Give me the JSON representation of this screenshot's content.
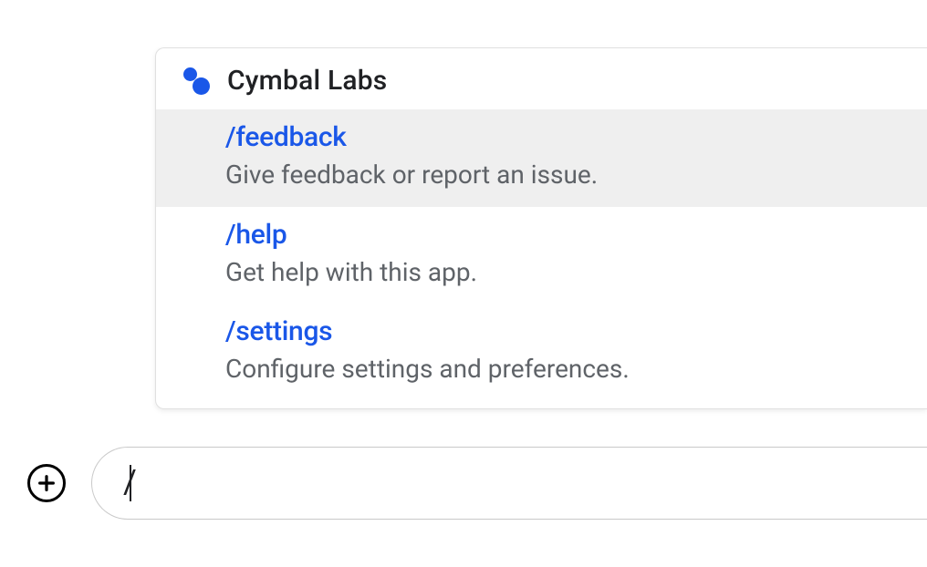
{
  "popup": {
    "title": "Cymbal Labs",
    "commands": [
      {
        "name": "/feedback",
        "description": "Give feedback or report an issue.",
        "selected": true
      },
      {
        "name": "/help",
        "description": "Get help with this app.",
        "selected": false
      },
      {
        "name": "/settings",
        "description": "Configure settings and preferences.",
        "selected": false
      }
    ]
  },
  "input": {
    "value": "/"
  }
}
